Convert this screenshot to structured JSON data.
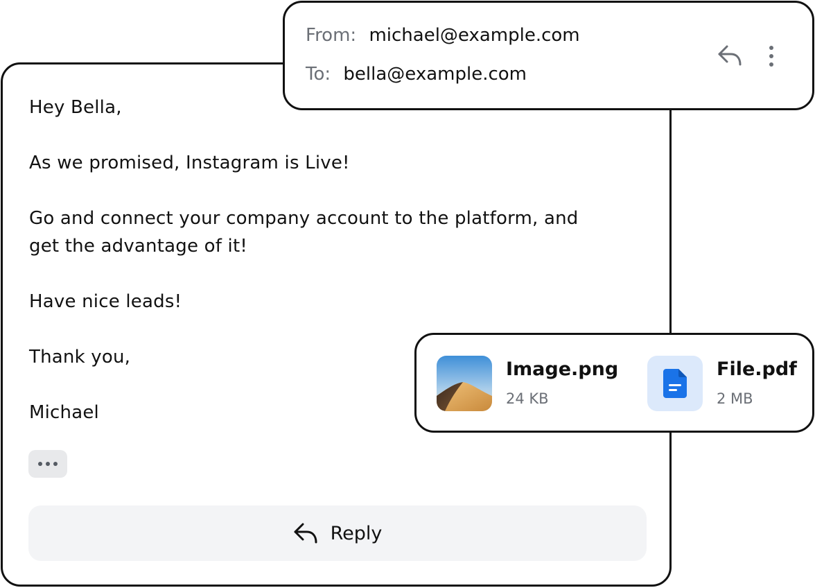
{
  "email": {
    "greeting": "Hey Bella,",
    "paragraph1": "As we promised, Instagram is Live!",
    "paragraph2_line1": "Go and connect your company account to the platform, and",
    "paragraph2_line2": "get the advantage of it!",
    "paragraph3": "Have nice leads!",
    "closing": "Thank you,",
    "signature": "Michael",
    "reply_label": "Reply"
  },
  "header": {
    "from_label": "From:",
    "from_value": "michael@example.com",
    "to_label": "To:",
    "to_value": "bella@example.com"
  },
  "attachments": [
    {
      "name": "Image.png",
      "size": "24 KB",
      "icon": "image-thumbnail"
    },
    {
      "name": "File.pdf",
      "size": "2 MB",
      "icon": "document-icon"
    }
  ],
  "colors": {
    "border": "#111111",
    "muted_text": "#6b6f76",
    "reply_button_bg": "#f3f4f6",
    "pdf_icon_bg": "#dce9fb",
    "pdf_icon": "#1a73e8"
  }
}
